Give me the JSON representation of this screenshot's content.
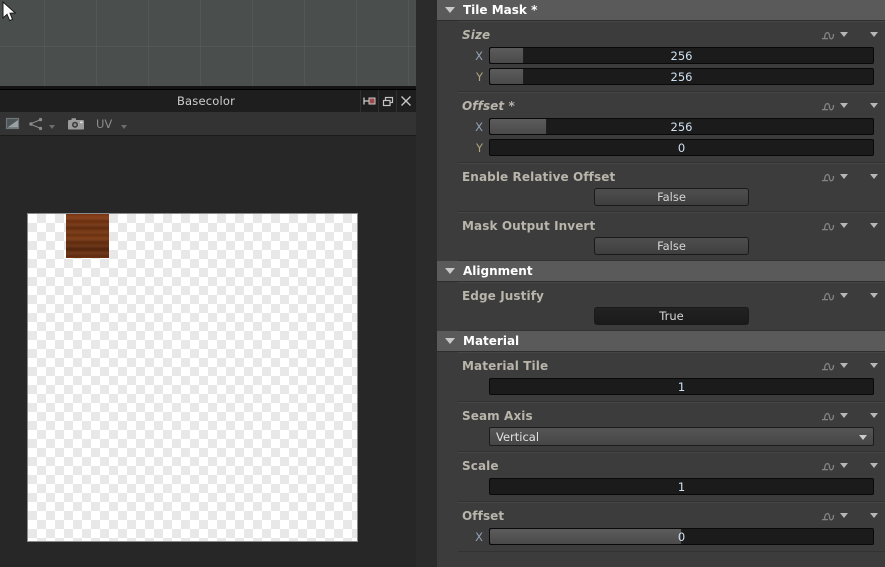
{
  "viewport": {
    "name": "3d-viewport",
    "cursor_icon": "mouse-pointer-icon"
  },
  "basecolor_window": {
    "title": "Basecolor",
    "window_buttons": [
      {
        "name": "dock-pin-button",
        "icon": "pin-icon"
      },
      {
        "name": "maximize-restore-button",
        "icon": "restore-window-icon"
      },
      {
        "name": "close-button",
        "icon": "close-icon"
      }
    ],
    "toolbar": {
      "items": [
        {
          "name": "view-settings-button",
          "icon": "display-settings-icon"
        },
        {
          "name": "channel-split-button",
          "icon": "node-graph-icon"
        },
        {
          "name": "screenshot-button",
          "icon": "camera-icon"
        }
      ],
      "uv_label": "UV"
    }
  },
  "properties": {
    "sections": [
      {
        "id": "tile-mask",
        "title": "Tile Mask *",
        "rows": [
          {
            "id": "size",
            "label": "Size",
            "italic": true,
            "type": "vector2",
            "axes": [
              {
                "axis": "X",
                "value": "256",
                "fill_pct": 9
              },
              {
                "axis": "Y",
                "value": "256",
                "fill_pct": 9
              }
            ]
          },
          {
            "id": "offset",
            "label": "Offset *",
            "italic": true,
            "type": "vector2",
            "axes": [
              {
                "axis": "X",
                "value": "256",
                "fill_pct": 15
              },
              {
                "axis": "Y",
                "value": "0",
                "fill_pct": 0
              }
            ]
          },
          {
            "id": "enable-relative-offset",
            "label": "Enable Relative Offset",
            "italic": false,
            "type": "boolean",
            "value": "False",
            "state": "off"
          },
          {
            "id": "mask-output-invert",
            "label": "Mask Output Invert",
            "italic": false,
            "type": "boolean",
            "value": "False",
            "state": "off"
          }
        ]
      },
      {
        "id": "alignment",
        "title": "Alignment",
        "rows": [
          {
            "id": "edge-justify",
            "label": "Edge Justify",
            "italic": false,
            "type": "boolean",
            "value": "True",
            "state": "on"
          }
        ]
      },
      {
        "id": "material",
        "title": "Material",
        "rows": [
          {
            "id": "material-tile",
            "label": "Material Tile",
            "italic": false,
            "type": "scalar",
            "value": "1",
            "fill_pct": 0
          },
          {
            "id": "seam-axis",
            "label": "Seam Axis",
            "italic": false,
            "type": "dropdown",
            "value": "Vertical"
          },
          {
            "id": "scale",
            "label": "Scale",
            "italic": false,
            "type": "scalar",
            "value": "1",
            "fill_pct": 0
          },
          {
            "id": "material-offset",
            "label": "Offset",
            "italic": false,
            "type": "vector2",
            "axes": [
              {
                "axis": "X",
                "value": "0",
                "fill_pct": 50
              }
            ]
          }
        ]
      }
    ],
    "row_icons": {
      "function_icon": "function-curve-icon",
      "dropdown_icon": "chevron-down-icon"
    }
  },
  "colors": {
    "panel_bg": "#3c3c3c",
    "section_header_bg": "#5a5a5a",
    "label": "#b9b5ab",
    "value": "#cfe0f0",
    "axis_x": "#93a2b5",
    "axis_y": "#b0a57e"
  }
}
